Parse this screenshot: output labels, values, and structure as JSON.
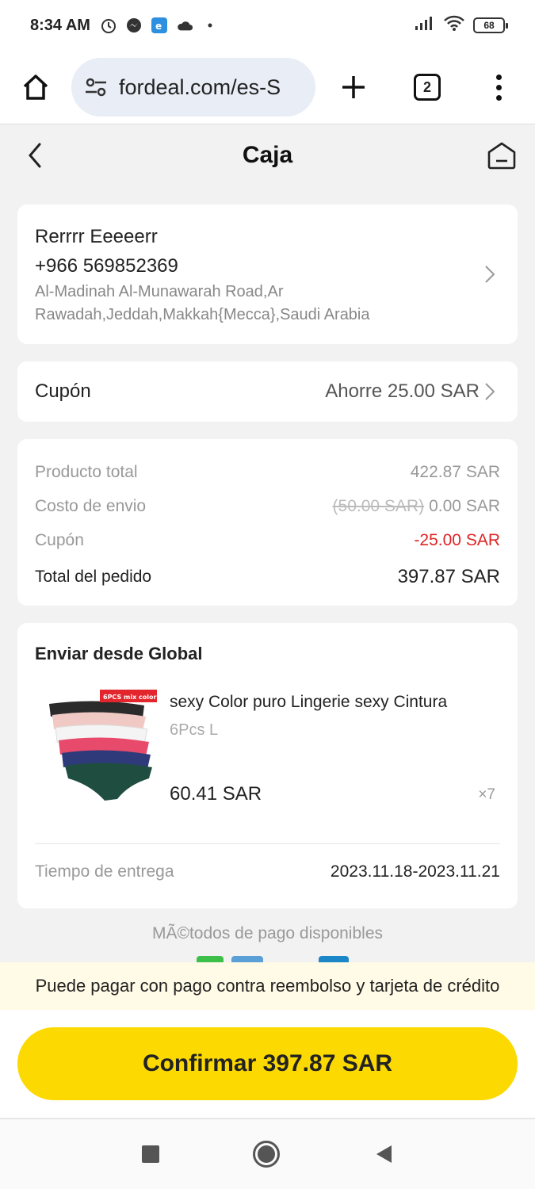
{
  "status_bar": {
    "time": "8:34 AM",
    "battery": "68"
  },
  "browser": {
    "url": "fordeal.com/es-S",
    "tab_count": "2"
  },
  "header": {
    "title": "Caja"
  },
  "address": {
    "name": "Rerrrr Eeeeerr",
    "phone": "+966 569852369",
    "line1": "Al-Madinah Al-Munawarah Road,Ar",
    "line2": "Rawadah,Jeddah,Makkah{Mecca},Saudi Arabia"
  },
  "coupon": {
    "label": "Cupón",
    "value": "Ahorre 25.00 SAR"
  },
  "summary": {
    "product_total_label": "Producto total",
    "product_total_value": "422.87 SAR",
    "shipping_label": "Costo de envio",
    "shipping_original": "(50.00 SAR)",
    "shipping_value": "0.00 SAR",
    "coupon_label": "Cupón",
    "coupon_value": "-25.00 SAR",
    "order_total_label": "Total del pedido",
    "order_total_value": "397.87 SAR"
  },
  "shipment": {
    "title": "Enviar desde Global",
    "product": {
      "name": "sexy Color puro Lingerie sexy Cintura",
      "variant": "6Pcs L",
      "price": "60.41 SAR",
      "quantity": "×7",
      "image_tag": "6PCS mix color"
    },
    "delivery_label": "Tiempo de entrega",
    "delivery_value": "2023.11.18-2023.11.21"
  },
  "payment": {
    "methods_title": "MÃ©todos de pago disponibles",
    "cod_notice": "Puede pagar con pago contra reembolso y tarjeta de crédito"
  },
  "confirm_button": "Confirmar 397.87 SAR",
  "colors": {
    "accent_yellow": "#fcd900",
    "discount_red": "#e02424"
  }
}
